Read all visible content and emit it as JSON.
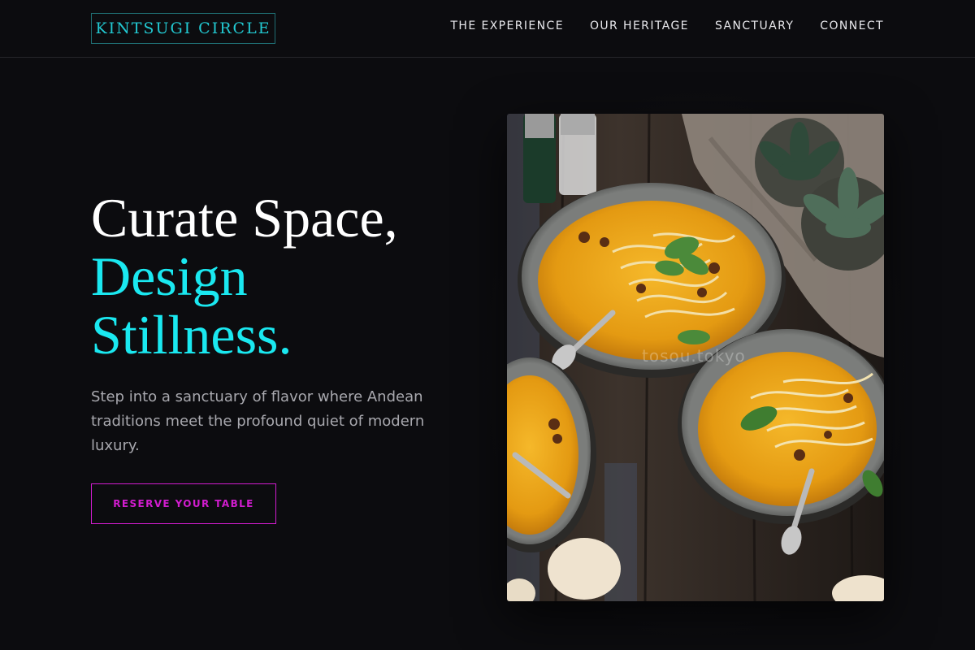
{
  "brand": {
    "logo_text": "KINTSUGI CIRCLE"
  },
  "nav": {
    "items": [
      {
        "label": "THE EXPERIENCE"
      },
      {
        "label": "OUR HERITAGE"
      },
      {
        "label": "SANCTUARY"
      },
      {
        "label": "CONNECT"
      }
    ]
  },
  "hero": {
    "headline_line1": "Curate Space,",
    "headline_accent_1": "Design",
    "headline_accent_2": "Stillness.",
    "subtitle": "Step into a sanctuary of flavor where Andean traditions meet the profound quiet of modern luxury.",
    "cta_label": "RESERVE YOUR TABLE"
  },
  "image": {
    "watermark": "tosou.tokyo"
  },
  "colors": {
    "background": "#0c0c0f",
    "accent_cyan": "#1ae8f0",
    "accent_magenta": "#d21ccf",
    "text_muted": "#a8a8ae"
  }
}
